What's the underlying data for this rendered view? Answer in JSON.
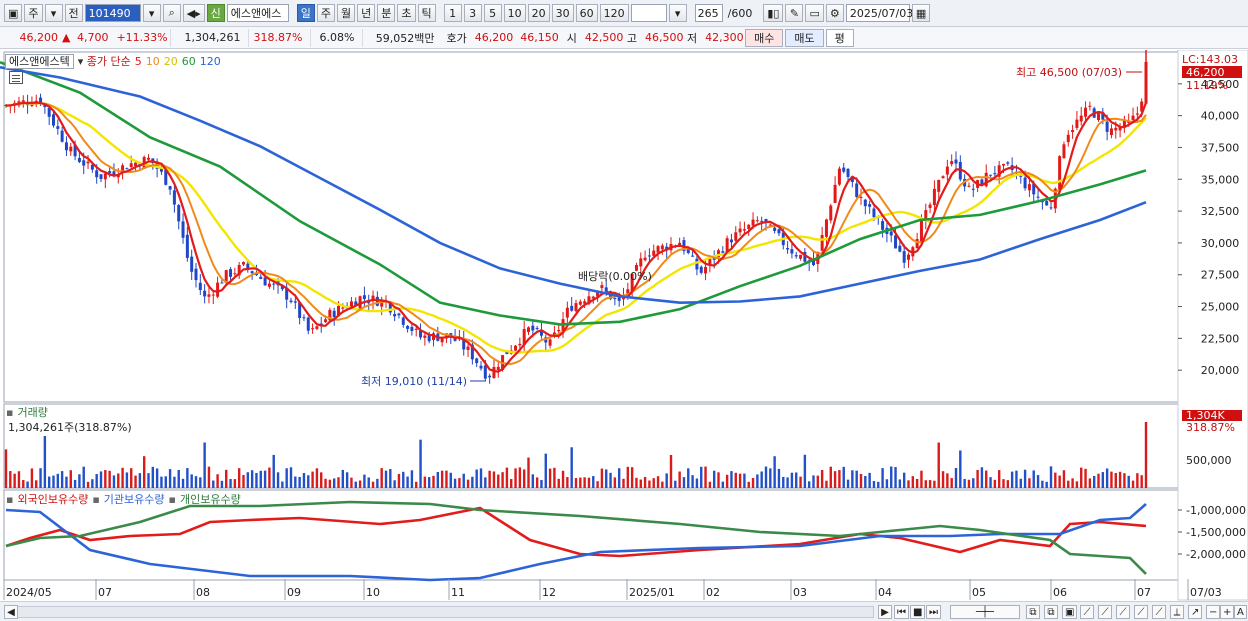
{
  "toolbar": {
    "market": "주",
    "prev_label": "전",
    "code": "101490",
    "credit_badge": "신",
    "stock_name": "에스앤에스",
    "periods": [
      "일",
      "주",
      "월",
      "년",
      "분",
      "초",
      "틱"
    ],
    "active_period": "일",
    "units": [
      "1",
      "3",
      "5",
      "10",
      "20",
      "30",
      "60",
      "120"
    ],
    "count": "265",
    "count_total": "/600",
    "date": "2025/07/03"
  },
  "quote": {
    "price": "46,200",
    "change": "4,700",
    "change_arrow": "▲",
    "change_pct": "+11.33%",
    "volume": "1,304,261",
    "volume_ratio": "318.87%",
    "turnover": "6.08%",
    "amount": "59,052백만",
    "bid_label": "호가",
    "ask": "46,200",
    "bid": "46,150",
    "open_label": "시",
    "open": "42,500",
    "high_label": "고",
    "high": "46,500",
    "low_label": "저",
    "low": "42,300",
    "buy_label": "매수",
    "sell_label": "매도",
    "eval_label": "평"
  },
  "legend": {
    "name": "에스앤에스텍",
    "ma_title": "종가 단순",
    "ma": [
      {
        "period": "5",
        "color": "#e21b1b"
      },
      {
        "period": "10",
        "color": "#f08a1a"
      },
      {
        "period": "20",
        "color": "#e8d800"
      },
      {
        "period": "60",
        "color": "#1e9a3a"
      },
      {
        "period": "120",
        "color": "#2c64d8"
      }
    ]
  },
  "annotations": {
    "lc": "LC:143.03",
    "last_price": "46,200",
    "last_pct": "11.19%",
    "high": "최고 46,500 (07/03)",
    "low": "최저 19,010 (11/14)",
    "dividend": "배당락(0.00%)"
  },
  "volume_panel": {
    "title": "거래량",
    "value": "1,304,261주(318.87%)",
    "badge": "1,304K",
    "badge_pct": "318.87%",
    "axis_label": "500,000"
  },
  "holdings_panel": {
    "legends": [
      "외국인보유수량",
      "기관보유수량",
      "개인보유수량"
    ],
    "colors": [
      "#e21b1b",
      "#2c64d8",
      "#3a8a4a"
    ],
    "axis_labels": [
      "-1,000,000",
      "-1,500,000",
      "-2,000,000"
    ]
  },
  "chart_data": {
    "type": "candlestick",
    "y_axis_ticks": [
      "42,500",
      "40,000",
      "37,500",
      "35,000",
      "32,500",
      "30,000",
      "27,500",
      "25,000",
      "22,500",
      "20,000"
    ],
    "ylim": [
      17500,
      45000
    ],
    "x_axis_labels": [
      "2024/05",
      "07",
      "08",
      "09",
      "10",
      "11",
      "12",
      "2025/01",
      "02",
      "03",
      "04",
      "05",
      "06",
      "07",
      "07/03"
    ],
    "ma_shape": {
      "ma120": [
        [
          0,
          43800
        ],
        [
          60,
          43000
        ],
        [
          140,
          41500
        ],
        [
          200,
          39600
        ],
        [
          260,
          37600
        ],
        [
          320,
          35100
        ],
        [
          380,
          32600
        ],
        [
          440,
          30000
        ],
        [
          500,
          28000
        ],
        [
          560,
          26800
        ],
        [
          620,
          25800
        ],
        [
          680,
          25300
        ],
        [
          740,
          25400
        ],
        [
          800,
          25800
        ],
        [
          860,
          26800
        ],
        [
          920,
          27800
        ],
        [
          980,
          28700
        ],
        [
          1040,
          30300
        ],
        [
          1100,
          31800
        ],
        [
          1146,
          33200
        ]
      ],
      "ma60": [
        [
          0,
          44200
        ],
        [
          80,
          41800
        ],
        [
          150,
          38300
        ],
        [
          220,
          36000
        ],
        [
          300,
          31700
        ],
        [
          380,
          28300
        ],
        [
          440,
          25300
        ],
        [
          500,
          24300
        ],
        [
          560,
          23600
        ],
        [
          620,
          23800
        ],
        [
          680,
          24800
        ],
        [
          740,
          26600
        ],
        [
          800,
          28200
        ],
        [
          860,
          30300
        ],
        [
          920,
          31800
        ],
        [
          980,
          32200
        ],
        [
          1040,
          33300
        ],
        [
          1100,
          34600
        ],
        [
          1146,
          35700
        ]
      ]
    }
  }
}
